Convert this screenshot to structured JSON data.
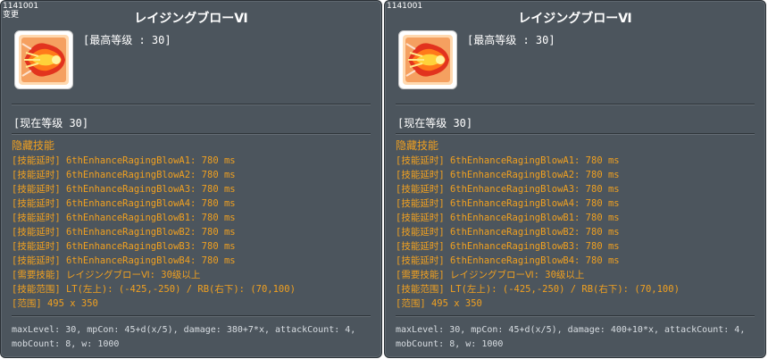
{
  "panels": [
    {
      "id_text": "1141001",
      "tag": "变更",
      "title": "レイジングブローⅥ",
      "icon": "raging-blow-skill-icon",
      "max_level": "[最高等级 : 30]",
      "current_level": "[现在等级 30]",
      "hidden_skill_title": "隐藏技能",
      "delays": [
        "[技能延时] 6thEnhanceRagingBlowA1: 780 ms",
        "[技能延时] 6thEnhanceRagingBlowA2: 780 ms",
        "[技能延时] 6thEnhanceRagingBlowA3: 780 ms",
        "[技能延时] 6thEnhanceRagingBlowA4: 780 ms",
        "[技能延时] 6thEnhanceRagingBlowB1: 780 ms",
        "[技能延时] 6thEnhanceRagingBlowB2: 780 ms",
        "[技能延时] 6thEnhanceRagingBlowB3: 780 ms",
        "[技能延时] 6thEnhanceRagingBlowB4: 780 ms"
      ],
      "required_skill": "[需要技能] レイジングブローⅥ: 30级以上",
      "skill_range": "[技能范围] LT(左上): (-425,-250) / RB(右下): (70,100)",
      "range": "[范围] 495 x 350",
      "code_line1": "maxLevel: 30, mpCon: 45+d(x/5), damage: 380+7*x, attackCount: 4,",
      "code_line2": "mobCount: 8, w: 1000"
    },
    {
      "id_text": "1141001",
      "tag": "",
      "title": "レイジングブローⅥ",
      "icon": "raging-blow-skill-icon",
      "max_level": "[最高等级 : 30]",
      "current_level": "[现在等级 30]",
      "hidden_skill_title": "隐藏技能",
      "delays": [
        "[技能延时] 6thEnhanceRagingBlowA1: 780 ms",
        "[技能延时] 6thEnhanceRagingBlowA2: 780 ms",
        "[技能延时] 6thEnhanceRagingBlowA3: 780 ms",
        "[技能延时] 6thEnhanceRagingBlowA4: 780 ms",
        "[技能延时] 6thEnhanceRagingBlowB1: 780 ms",
        "[技能延时] 6thEnhanceRagingBlowB2: 780 ms",
        "[技能延时] 6thEnhanceRagingBlowB3: 780 ms",
        "[技能延时] 6thEnhanceRagingBlowB4: 780 ms"
      ],
      "required_skill": "[需要技能] レイジングブローⅥ: 30级以上",
      "skill_range": "[技能范围] LT(左上): (-425,-250) / RB(右下): (70,100)",
      "range": "[范围] 495 x 350",
      "code_line1": "maxLevel: 30, mpCon: 45+d(x/5), damage: 400+10*x, attackCount: 4,",
      "code_line2": "mobCount: 8, w: 1000"
    }
  ],
  "colors": {
    "panel_bg": "#4c555d",
    "detail_text": "#f0a020",
    "code_text": "#d8dde2"
  }
}
